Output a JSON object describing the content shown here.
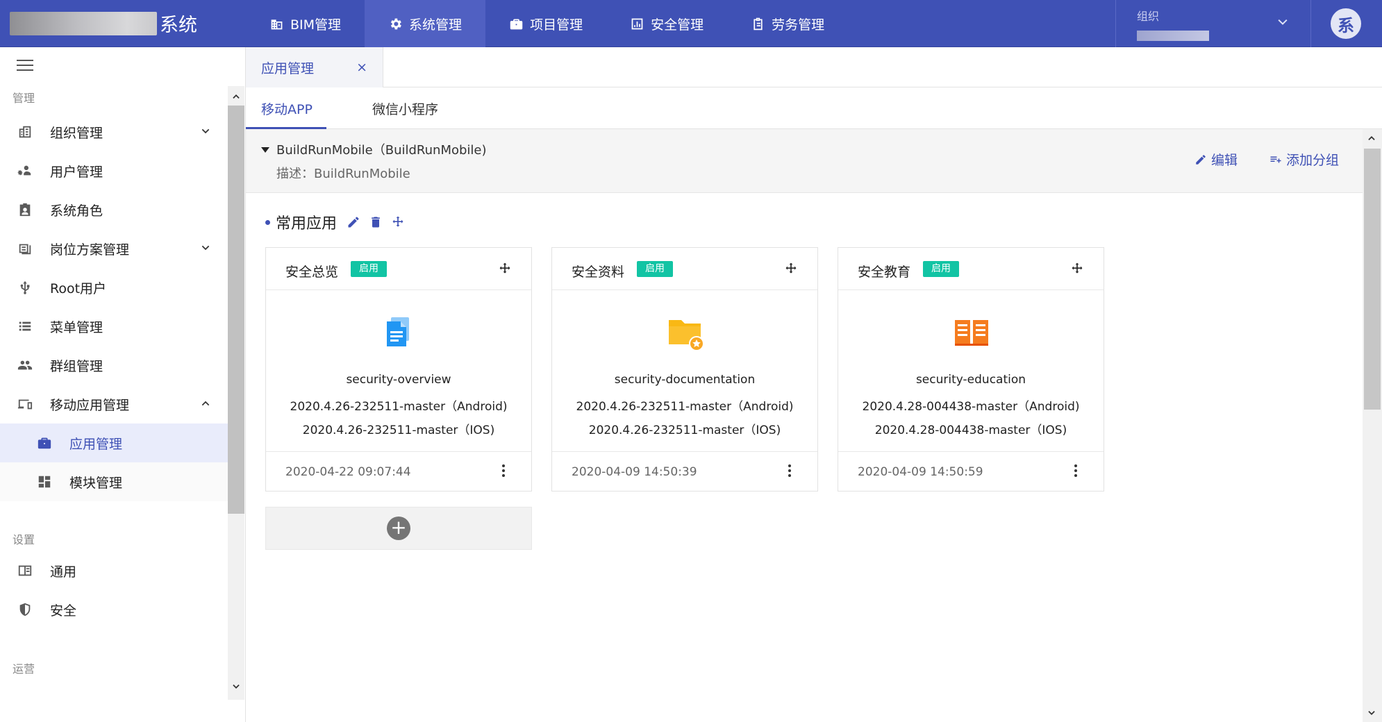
{
  "brand": {
    "title": "系统"
  },
  "topnav": [
    {
      "label": "BIM管理",
      "icon": "building-icon"
    },
    {
      "label": "系统管理",
      "icon": "gear-icon"
    },
    {
      "label": "项目管理",
      "icon": "briefcase-icon"
    },
    {
      "label": "安全管理",
      "icon": "bar-chart-icon"
    },
    {
      "label": "劳务管理",
      "icon": "clipboard-icon"
    }
  ],
  "org": {
    "label": "组织"
  },
  "avatar": {
    "text": "系"
  },
  "sidebar": {
    "sections": {
      "manage": "管理",
      "settings": "设置",
      "ops": "运营"
    },
    "items": [
      {
        "label": "组织管理",
        "icon": "organization-icon"
      },
      {
        "label": "用户管理",
        "icon": "user-icon"
      },
      {
        "label": "系统角色",
        "icon": "role-badge-icon"
      },
      {
        "label": "岗位方案管理",
        "icon": "list-icon"
      },
      {
        "label": "Root用户",
        "icon": "usb-icon"
      },
      {
        "label": "菜单管理",
        "icon": "menu-list-icon"
      },
      {
        "label": "群组管理",
        "icon": "group-icon"
      },
      {
        "label": "移动应用管理",
        "icon": "devices-icon"
      },
      {
        "label": "应用管理",
        "icon": "briefcase-icon"
      },
      {
        "label": "模块管理",
        "icon": "dashboard-icon"
      },
      {
        "label": "通用",
        "icon": "book-icon"
      },
      {
        "label": "安全",
        "icon": "shield-icon"
      }
    ]
  },
  "page_tab": {
    "label": "应用管理",
    "close": "×"
  },
  "subtabs": [
    {
      "label": "移动APP"
    },
    {
      "label": "微信小程序"
    }
  ],
  "group": {
    "title": "BuildRunMobile（BuildRunMobile)",
    "desc": "描述：BuildRunMobile",
    "edit": "编辑",
    "add_group": "添加分组"
  },
  "common": {
    "title": "常用应用"
  },
  "cards": [
    {
      "name": "安全总览",
      "badge": "启用",
      "app": "security-overview",
      "android": "2020.4.26-232511-master（Android)",
      "ios": "2020.4.26-232511-master（IOS)",
      "date": "2020-04-22 09:07:44",
      "icon": "document-icon",
      "icon_color": "#2196f3"
    },
    {
      "name": "安全资料",
      "badge": "启用",
      "app": "security-documentation",
      "android": "2020.4.26-232511-master（Android)",
      "ios": "2020.4.26-232511-master（IOS)",
      "date": "2020-04-09 14:50:39",
      "icon": "folder-star-icon",
      "icon_color": "#f9b814"
    },
    {
      "name": "安全教育",
      "badge": "启用",
      "app": "security-education",
      "android": "2020.4.28-004438-master（Android)",
      "ios": "2020.4.28-004438-master（IOS)",
      "date": "2020-04-09 14:50:59",
      "icon": "open-book-icon",
      "icon_color": "#f57c1f"
    }
  ],
  "colors": {
    "primary": "#3f51b5",
    "badge": "#12c4a4",
    "active_bg": "#e9ecfb"
  }
}
